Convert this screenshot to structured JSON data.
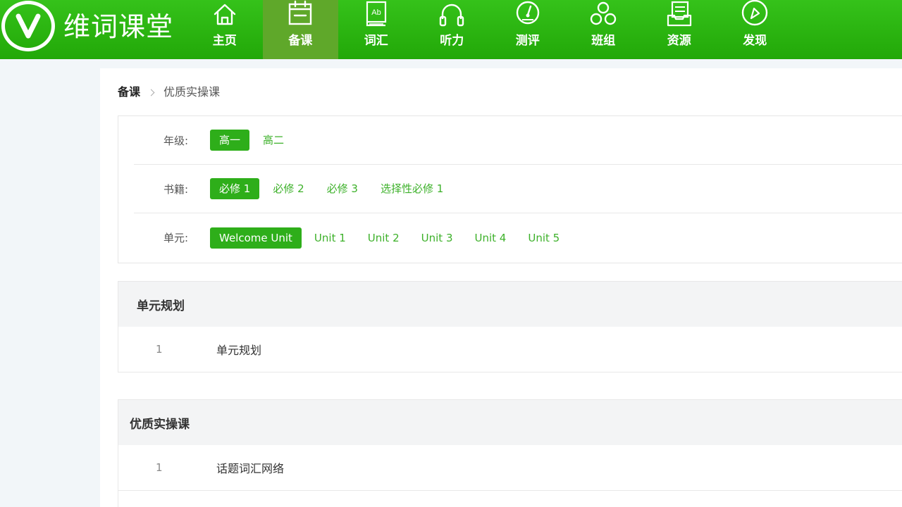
{
  "brand": {
    "logo_letter": "V",
    "name": "维词课堂"
  },
  "nav": {
    "items": [
      {
        "label": "主页",
        "icon": "home-icon"
      },
      {
        "label": "备课",
        "icon": "calendar-icon",
        "active": true
      },
      {
        "label": "词汇",
        "icon": "book-icon"
      },
      {
        "label": "听力",
        "icon": "headphones-icon"
      },
      {
        "label": "测评",
        "icon": "gauge-icon"
      },
      {
        "label": "班组",
        "icon": "group-icon"
      },
      {
        "label": "资源",
        "icon": "resource-icon"
      },
      {
        "label": "发现",
        "icon": "compass-icon"
      }
    ],
    "book_icon_text": "Ab"
  },
  "breadcrumb": {
    "root": "备课",
    "current": "优质实操课"
  },
  "filters": {
    "grade": {
      "label": "年级:",
      "options": [
        "高一",
        "高二"
      ],
      "selected": "高一"
    },
    "book": {
      "label": "书籍:",
      "options": [
        "必修 1",
        "必修 2",
        "必修 3",
        "选择性必修 1"
      ],
      "selected": "必修 1"
    },
    "unit": {
      "label": "单元:",
      "options": [
        "Welcome Unit",
        "Unit 1",
        "Unit 2",
        "Unit 3",
        "Unit 4",
        "Unit 5"
      ],
      "selected": "Welcome Unit"
    }
  },
  "sections": {
    "unit_plan": {
      "title": "单元规划",
      "rows": [
        {
          "index": "1",
          "title": "单元规划"
        }
      ]
    },
    "quality_lessons": {
      "title": "优质实操课",
      "rows": [
        {
          "index": "1",
          "title": "话题词汇网络"
        }
      ]
    }
  },
  "colors": {
    "brand_green": "#2eae1a",
    "active_nav_bg": "#5fa82a",
    "option_text": "#3db12a"
  }
}
